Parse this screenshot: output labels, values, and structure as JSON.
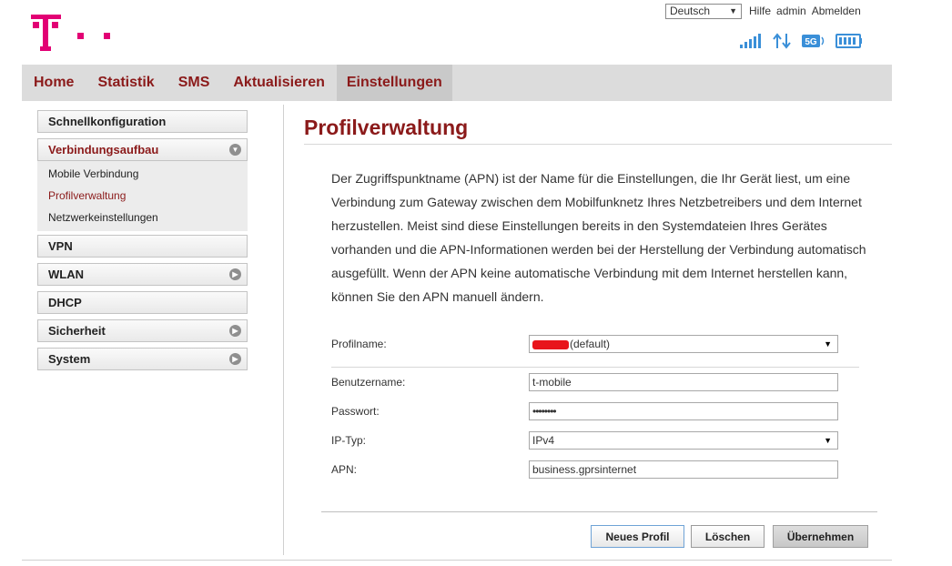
{
  "brand": {
    "color": "#e20074",
    "logo": "T-logo"
  },
  "topbar": {
    "language": "Deutsch",
    "links": [
      "Hilfe",
      "admin",
      "Abmelden"
    ]
  },
  "status_icons": [
    "signal-strength-icon",
    "data-transfer-icon",
    "5g-network-icon",
    "battery-icon"
  ],
  "nav": {
    "items": [
      "Home",
      "Statistik",
      "SMS",
      "Aktualisieren",
      "Einstellungen"
    ],
    "active": "Einstellungen"
  },
  "sidebar": {
    "schnell": "Schnellkonfiguration",
    "verbindung": "Verbindungsaufbau",
    "sub": [
      "Mobile Verbindung",
      "Profilverwaltung",
      "Netzwerkeinstellungen"
    ],
    "vpn": "VPN",
    "wlan": "WLAN",
    "dhcp": "DHCP",
    "sicherheit": "Sicherheit",
    "system": "System"
  },
  "page": {
    "title": "Profilverwaltung",
    "description": "Der Zugriffspunktname (APN) ist der Name für die Einstellungen, die Ihr Gerät liest, um eine Verbindung zum Gateway zwischen dem Mobilfunknetz Ihres Netzbetreibers und dem Internet herzustellen. Meist sind diese Einstellungen bereits in den Systemdateien Ihres Gerätes vorhanden und die APN-Informationen werden bei der Herstellung der Verbindung automatisch ausgefüllt. Wenn der APN keine automatische Verbindung mit dem Internet herstellen kann, können Sie den APN manuell ändern."
  },
  "form": {
    "profilname_label": "Profilname:",
    "profilname_value": "(default)",
    "benutzername_label": "Benutzername:",
    "benutzername_value": "t-mobile",
    "passwort_label": "Passwort:",
    "passwort_value": "••••••••",
    "iptyp_label": "IP-Typ:",
    "iptyp_value": "IPv4",
    "apn_label": "APN:",
    "apn_value": "business.gprsinternet"
  },
  "buttons": {
    "neues": "Neues Profil",
    "loeschen": "Löschen",
    "uebernehmen": "Übernehmen"
  }
}
